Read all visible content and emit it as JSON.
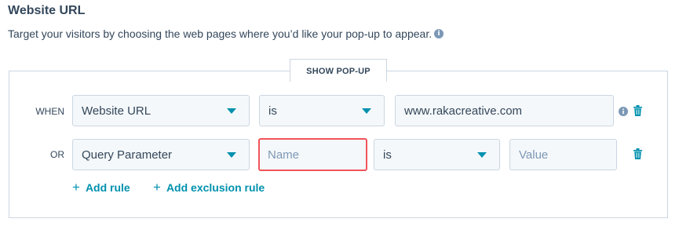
{
  "header": {
    "title": "Website URL",
    "description": "Target your visitors by choosing the web pages where you’d like your pop-up to appear."
  },
  "panel": {
    "tab_label": "SHOW POP-UP"
  },
  "rules": [
    {
      "connector": "WHEN",
      "field": "Website URL",
      "operator": "is",
      "value": "www.rakacreative.com"
    },
    {
      "connector": "OR",
      "field": "Query Parameter",
      "name_placeholder": "Name",
      "operator": "is",
      "value_placeholder": "Value"
    }
  ],
  "actions": {
    "add_rule": "Add rule",
    "add_exclusion_rule": "Add exclusion rule"
  },
  "colors": {
    "accent": "#0091ae",
    "error": "#f2545b",
    "text": "#33475b",
    "border": "#cbd6e2",
    "input_bg": "#f5f8fa"
  }
}
